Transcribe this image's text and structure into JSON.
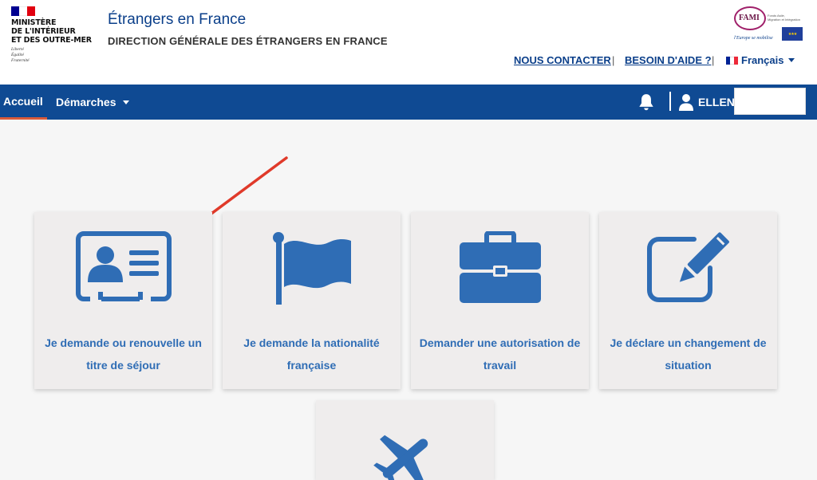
{
  "header": {
    "ministry_name": "MINISTÈRE\nDE L'INTÉRIEUR\nET DES OUTRE-MER",
    "motto": "Liberté\nÉgalité\nFraternité",
    "site_title": "Étrangers en France",
    "site_subtitle": "DIRECTION GÉNÉRALE DES ÉTRANGERS EN FRANCE",
    "partner_logo": {
      "name": "FAMI",
      "small_text": "Fonds Asile,\nMigration et Intégration",
      "tagline": "l'Europe se mobilise"
    },
    "links": {
      "contact": "NOUS CONTACTER",
      "help": "BESOIN D'AIDE ?",
      "separator": "|",
      "language": "Français"
    }
  },
  "navbar": {
    "home": "Accueil",
    "demarches": "Démarches",
    "user_name": "ELLEN",
    "user_box_value": ""
  },
  "tiles": [
    {
      "label": "Je demande ou renouvelle un titre de séjour",
      "icon": "id-card-icon"
    },
    {
      "label": "Je demande la nationalité française",
      "icon": "flag-icon"
    },
    {
      "label": "Demander une autorisation de travail",
      "icon": "briefcase-icon"
    },
    {
      "label": "Je déclare un changement de situation",
      "icon": "edit-icon"
    },
    {
      "label": "",
      "icon": "airplane-icon"
    }
  ],
  "colors": {
    "nav_blue": "#0f4a93",
    "tile_icon_blue": "#2f6db5",
    "tile_bg": "#efeded",
    "arrow_red": "#e03a2a",
    "active_underline": "#d95a3a"
  }
}
